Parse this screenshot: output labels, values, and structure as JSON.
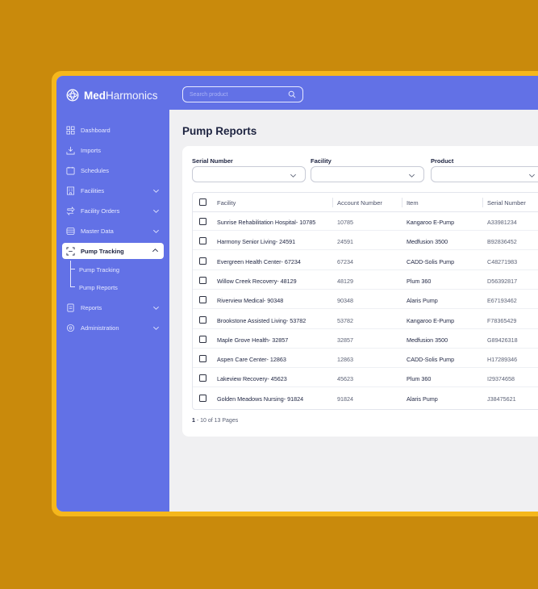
{
  "app": {
    "brand_bold": "Med",
    "brand_rest": "Harmonics"
  },
  "search": {
    "placeholder": "Search product"
  },
  "sidebar": {
    "items": [
      {
        "label": "Dashboard",
        "icon": "dashboard-grid-icon"
      },
      {
        "label": "Imports",
        "icon": "import-tray-icon"
      },
      {
        "label": "Schedules",
        "icon": "calendar-icon"
      },
      {
        "label": "Facilities",
        "icon": "building-icon",
        "expandable": true
      },
      {
        "label": "Facility Orders",
        "icon": "order-icon",
        "expandable": true
      },
      {
        "label": "Master Data",
        "icon": "database-icon",
        "expandable": true
      },
      {
        "label": "Pump Tracking",
        "icon": "scan-icon",
        "active": true,
        "expanded": true
      },
      {
        "label": "Reports",
        "icon": "report-icon",
        "expandable": true
      },
      {
        "label": "Administration",
        "icon": "admin-gear-icon",
        "expandable": true
      }
    ],
    "sub_items": [
      "Pump Tracking",
      "Pump Reports"
    ]
  },
  "page": {
    "title": "Pump Reports"
  },
  "filters": [
    {
      "label": "Serial Number",
      "value": ""
    },
    {
      "label": "Facility",
      "value": ""
    },
    {
      "label": "Product",
      "value": ""
    }
  ],
  "table": {
    "columns": [
      "Facility",
      "Account Number",
      "Item",
      "Serial Number"
    ],
    "rows": [
      [
        "Sunrise Rehabilitation Hospital- 10785",
        "10785",
        "Kangaroo E-Pump",
        "A33981234"
      ],
      [
        "Harmony Senior Living- 24591",
        "24591",
        "Medfusion 3500",
        "B92836452"
      ],
      [
        "Evergreen Health Center- 67234",
        "67234",
        "CADD-Solis Pump",
        "C48271983"
      ],
      [
        "Willow Creek Recovery- 48129",
        "48129",
        "Plum 360",
        "D56392817"
      ],
      [
        "Riverview Medical- 90348",
        "90348",
        "Alaris Pump",
        "E67193462"
      ],
      [
        "Brookstone Assisted Living- 53782",
        "53782",
        "Kangaroo E-Pump",
        "F78365429"
      ],
      [
        "Maple Grove Health- 32857",
        "32857",
        "Medfusion 3500",
        "G89426318"
      ],
      [
        "Aspen Care Center- 12863",
        "12863",
        "CADD-Solis Pump",
        "H17289346"
      ],
      [
        "Lakeview Recovery- 45623",
        "45623",
        "Plum 360",
        "I29374658"
      ],
      [
        "Golden Meadows Nursing- 91824",
        "91824",
        "Alaris Pump",
        "J38475621"
      ]
    ]
  },
  "pager": {
    "current": "1",
    "rest": " - 10 of 13 Pages"
  },
  "colors": {
    "accent": "#6271e6",
    "frame": "#f5b71c",
    "background": "#c98a0c"
  }
}
